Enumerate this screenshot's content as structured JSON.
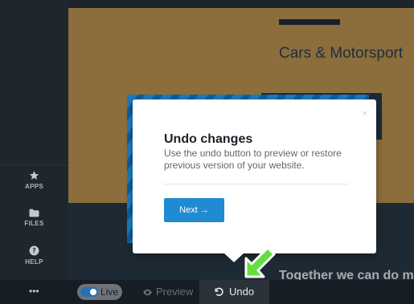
{
  "canvas": {
    "hero_title": "Cars & Motorsport",
    "band_text": "Together we can do m"
  },
  "sidebar": {
    "items": [
      {
        "label": "APPS",
        "icon": "star-icon"
      },
      {
        "label": "FILES",
        "icon": "folder-icon"
      },
      {
        "label": "HELP",
        "icon": "help-icon"
      }
    ],
    "more_label": "•••"
  },
  "bottombar": {
    "live_label": "Live",
    "preview_label": "Preview",
    "undo_label": "Undo"
  },
  "popup": {
    "close_label": "×",
    "title": "Undo changes",
    "description": "Use the undo button to preview or restore previous version of your website.",
    "next_label": "Next →"
  },
  "colors": {
    "accent": "#1f8bd3",
    "arrow": "#63df3f",
    "hero": "#8c6d3c"
  }
}
